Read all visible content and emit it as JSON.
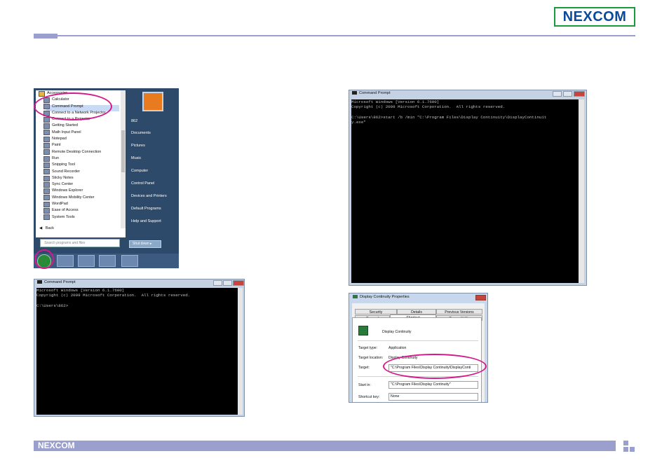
{
  "header": {
    "logo_text": "NEXCOM"
  },
  "footer": {
    "logo_text": "NEXCOM"
  },
  "start_menu": {
    "items": [
      "Accessories",
      "Calculator",
      "Command Prompt",
      "Connect to a Network Projector",
      "Connect to a Projector",
      "Getting Started",
      "Math Input Panel",
      "Notepad",
      "Paint",
      "Remote Desktop Connection",
      "Run",
      "Snipping Tool",
      "Sound Recorder",
      "Sticky Notes",
      "Sync Center",
      "Windows Explorer",
      "Windows Mobility Center",
      "WordPad",
      "Ease of Access",
      "System Tools"
    ],
    "back_label": "Back",
    "search_placeholder": "Search programs and files",
    "user": "862",
    "right_items": [
      "Documents",
      "Pictures",
      "Music",
      "Computer",
      "Control Panel",
      "Devices and Printers",
      "Default Programs",
      "Help and Support"
    ],
    "shutdown_label": "Shut down"
  },
  "cmd_large": {
    "title": "Command Prompt",
    "lines": [
      "Microsoft Windows [Version 6.1.7600]",
      "Copyright (c) 2009 Microsoft Corporation.  All rights reserved.",
      "",
      "C:\\Users\\862>start /b /min \"C:\\Program Files\\Display Continuity\\DisplayContinuit",
      "y.exe\""
    ]
  },
  "cmd_small": {
    "title": "Command Prompt",
    "lines": [
      "Microsoft Windows [Version 6.1.7600]",
      "Copyright (c) 2009 Microsoft Corporation.  All rights reserved.",
      "",
      "C:\\Users\\862>"
    ]
  },
  "properties": {
    "title": "Display Continuity Properties",
    "tabs_row1": [
      "Security",
      "Details",
      "Previous Versions"
    ],
    "tabs_row2": [
      "General",
      "Shortcut",
      "Compatibility"
    ],
    "app_name": "Display Continuity",
    "target_type_label": "Target type:",
    "target_type_value": "Application",
    "target_location_label": "Target location:",
    "target_location_value": "Display Continuity",
    "target_label": "Target:",
    "target_value": "\"C:\\Program Files\\Display Continuity\\DisplayConti",
    "start_in_label": "Start in:",
    "start_in_value": "\"C:\\Program Files\\Display Continuity\"",
    "shortcut_key_label": "Shortcut key:",
    "shortcut_key_value": "None"
  },
  "colors": {
    "accent": "#9a9fce",
    "highlight": "#d4198a"
  }
}
